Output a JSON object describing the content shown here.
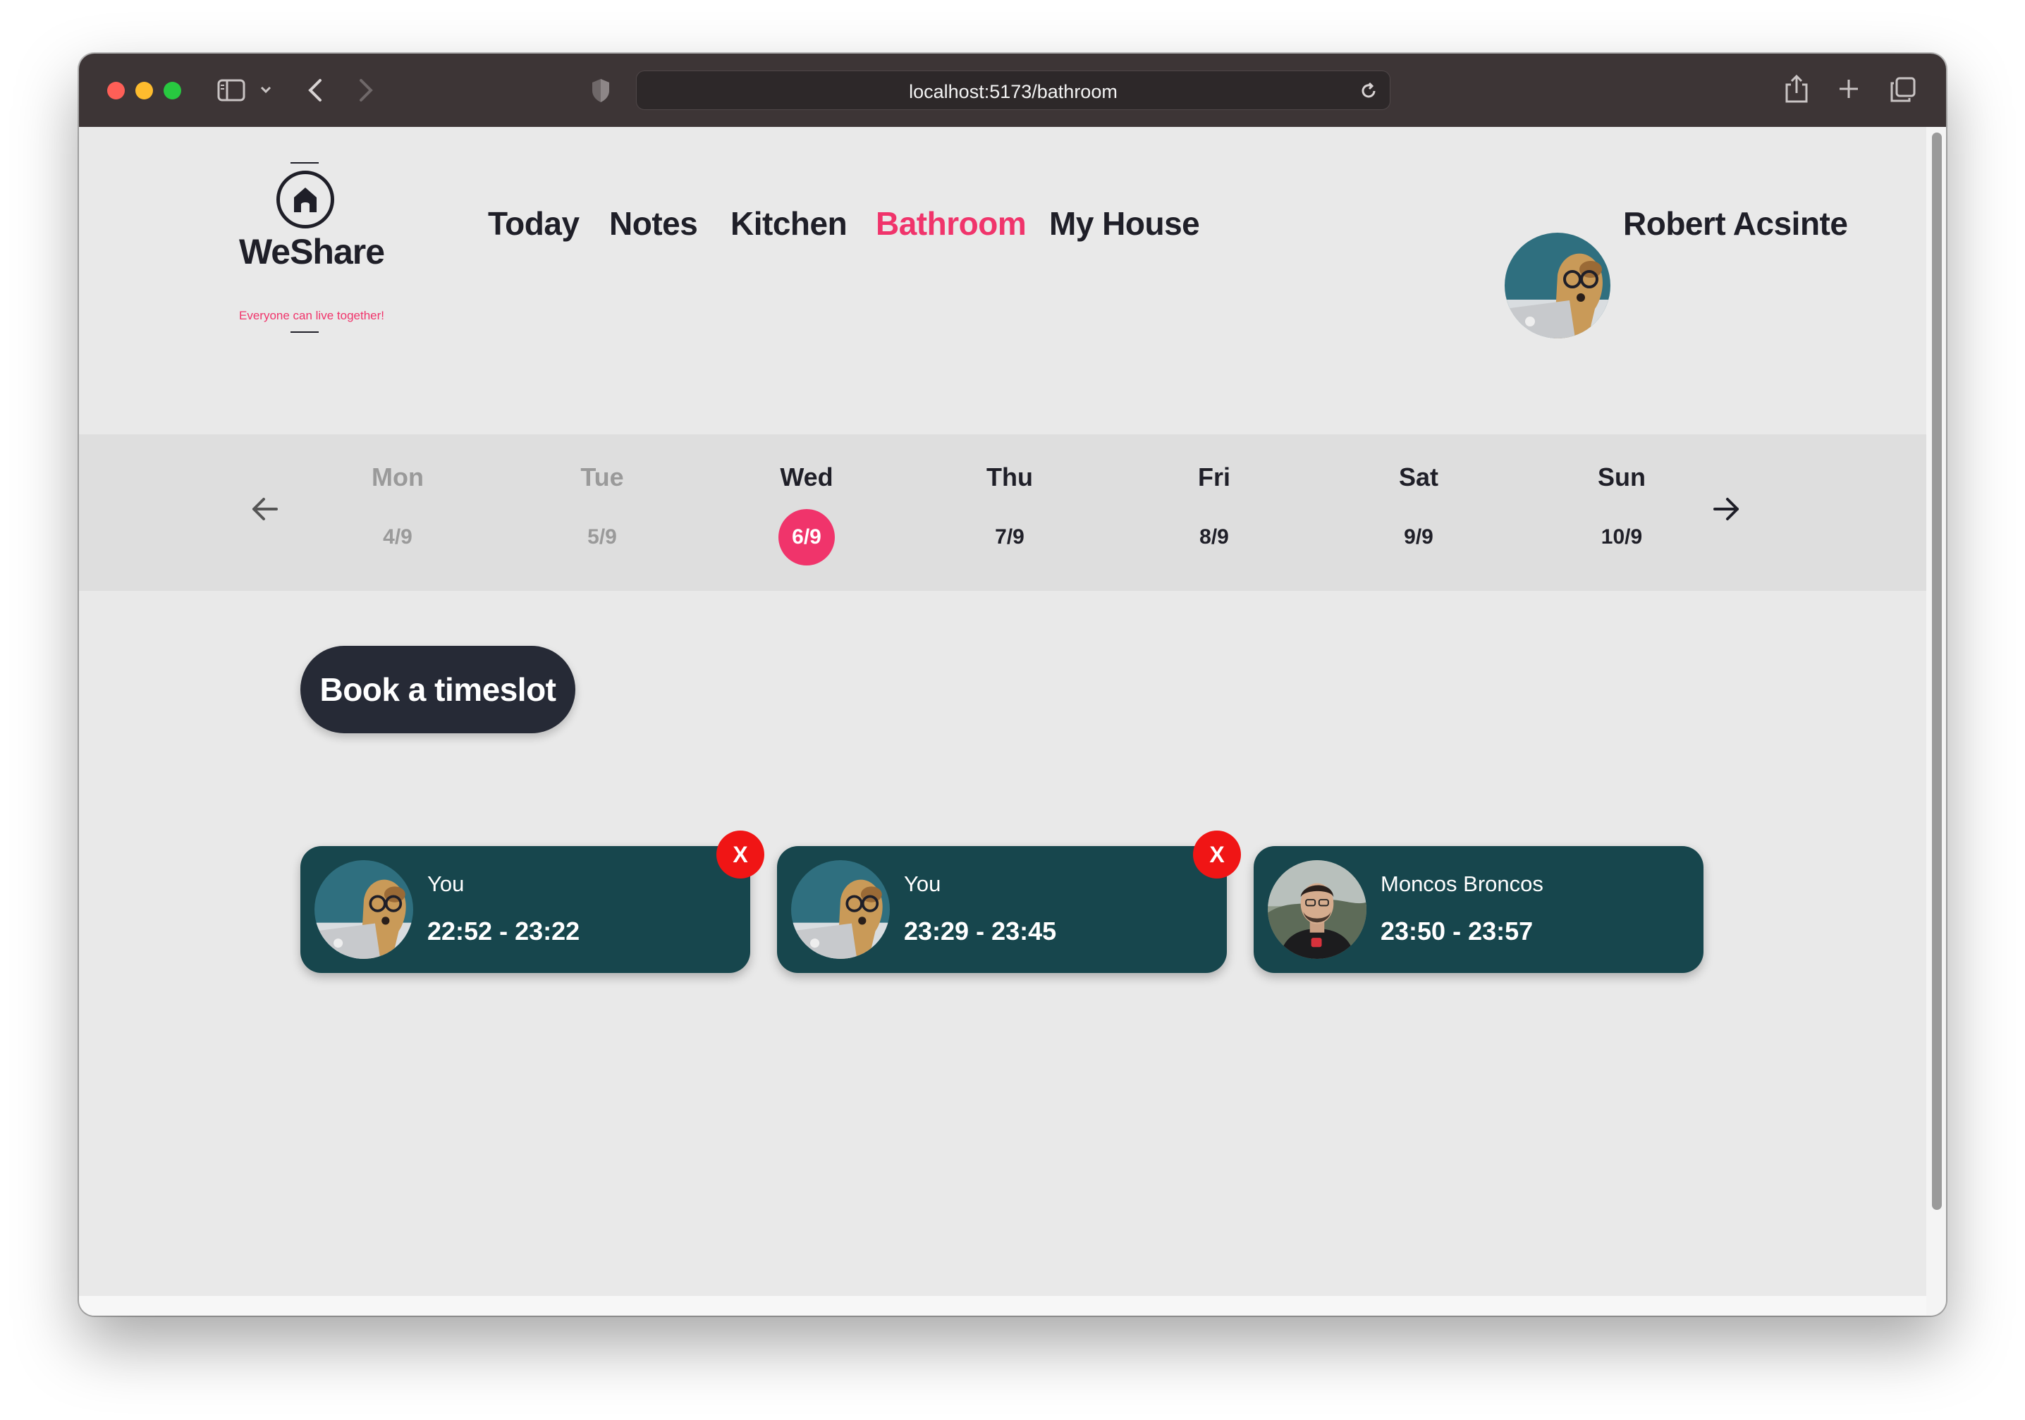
{
  "browser": {
    "url": "localhost:5173/bathroom",
    "traffic_lights": {
      "close": "#fe5f57",
      "minimize": "#febc2e",
      "maximize": "#28c840"
    }
  },
  "colors": {
    "accent": "#f0346b",
    "dark": "#1f1f28",
    "card": "#17464d",
    "remove": "#f01515",
    "muted": "#9a9a9a"
  },
  "logo": {
    "name": "WeShare",
    "tagline": "Everyone can live together!",
    "icon": "house-icon"
  },
  "nav": {
    "items": [
      {
        "label": "Today"
      },
      {
        "label": "Notes"
      },
      {
        "label": "Kitchen"
      },
      {
        "label": "Bathroom",
        "active": true
      },
      {
        "label": "My House"
      }
    ]
  },
  "user": {
    "name": "Robert Acsinte",
    "avatar": "dog-with-glasses-avatar"
  },
  "week": {
    "prev_icon": "arrow-left-icon",
    "next_icon": "arrow-right-icon",
    "days": [
      {
        "name": "Mon",
        "date": "4/9",
        "state": "past"
      },
      {
        "name": "Tue",
        "date": "5/9",
        "state": "past"
      },
      {
        "name": "Wed",
        "date": "6/9",
        "state": "selected"
      },
      {
        "name": "Thu",
        "date": "7/9",
        "state": "future"
      },
      {
        "name": "Fri",
        "date": "8/9",
        "state": "future"
      },
      {
        "name": "Sat",
        "date": "9/9",
        "state": "future"
      },
      {
        "name": "Sun",
        "date": "10/9",
        "state": "future"
      }
    ]
  },
  "actions": {
    "book_label": "Book a timeslot"
  },
  "bookings": [
    {
      "user": "You",
      "time": "22:52 - 23:22",
      "avatar": "dog-with-glasses-avatar",
      "removable": true,
      "remove_label": "X"
    },
    {
      "user": "You",
      "time": "23:29 - 23:45",
      "avatar": "dog-with-glasses-avatar",
      "removable": true,
      "remove_label": "X"
    },
    {
      "user": "Moncos Broncos",
      "time": "23:50 - 23:57",
      "avatar": "man-portrait-avatar",
      "removable": false
    }
  ]
}
